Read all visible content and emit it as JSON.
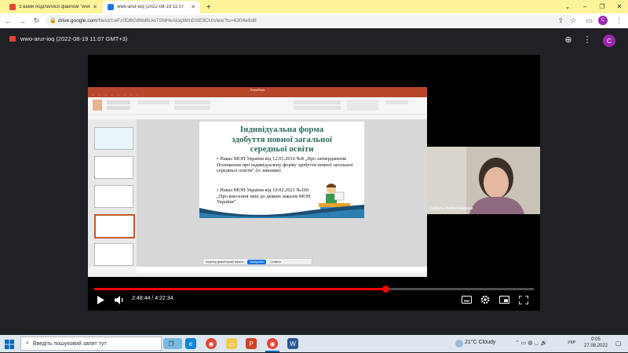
{
  "browser": {
    "tabs": [
      {
        "title": "З вами поділилися файлом \"wwo-",
        "favicon_color": "#ea4335",
        "active": false
      },
      {
        "title": "wwo-arur-ioq (2022-08-19 11:07",
        "favicon_color": "#1a73e8",
        "active": true
      }
    ],
    "new_tab": "+",
    "url_host": "drive.google.com",
    "url_path": "/file/d/1wFz0DBG8hbBUw7SNHeAiogWmDSE9CU/view?ts=6304e9d8"
  },
  "viewer": {
    "file_title": "wwo-arur-ioq (2022-08-19 11:07 GMT+3)",
    "avatar_letter": "C",
    "avatar_color": "#9c27b0"
  },
  "slide": {
    "title_lines": [
      "Індивідуальна форма",
      "здобуття повної загальної",
      "середньої освіти"
    ],
    "bullets": [
      "Наказ МОН України від 12.01.2016 №8 „Про затвердження Положення про індивідуальну форму здобуття повної загальної середньої освіти” (із змінами)",
      "Наказ МОН України від 10.02.2021 №160 „Про внесення змін до деяких наказів МОН України”"
    ]
  },
  "webcam": {
    "name": "Соболь Любов Іванівна"
  },
  "sharebar": {
    "text": "Ініціатор демонстрації екрана",
    "stop_label": "Завершити",
    "hide_label": "Сховати"
  },
  "player": {
    "time_current": "2:48:44",
    "time_total": "4:22:34",
    "progress_fraction": 0.664,
    "accent": "#ff0000"
  },
  "taskbar": {
    "search_placeholder": "Введіть пошуковий запит тут",
    "weather": "21°C  Cloudy",
    "lang": "УКР",
    "time": "0:05",
    "date": "27.08.2022"
  }
}
